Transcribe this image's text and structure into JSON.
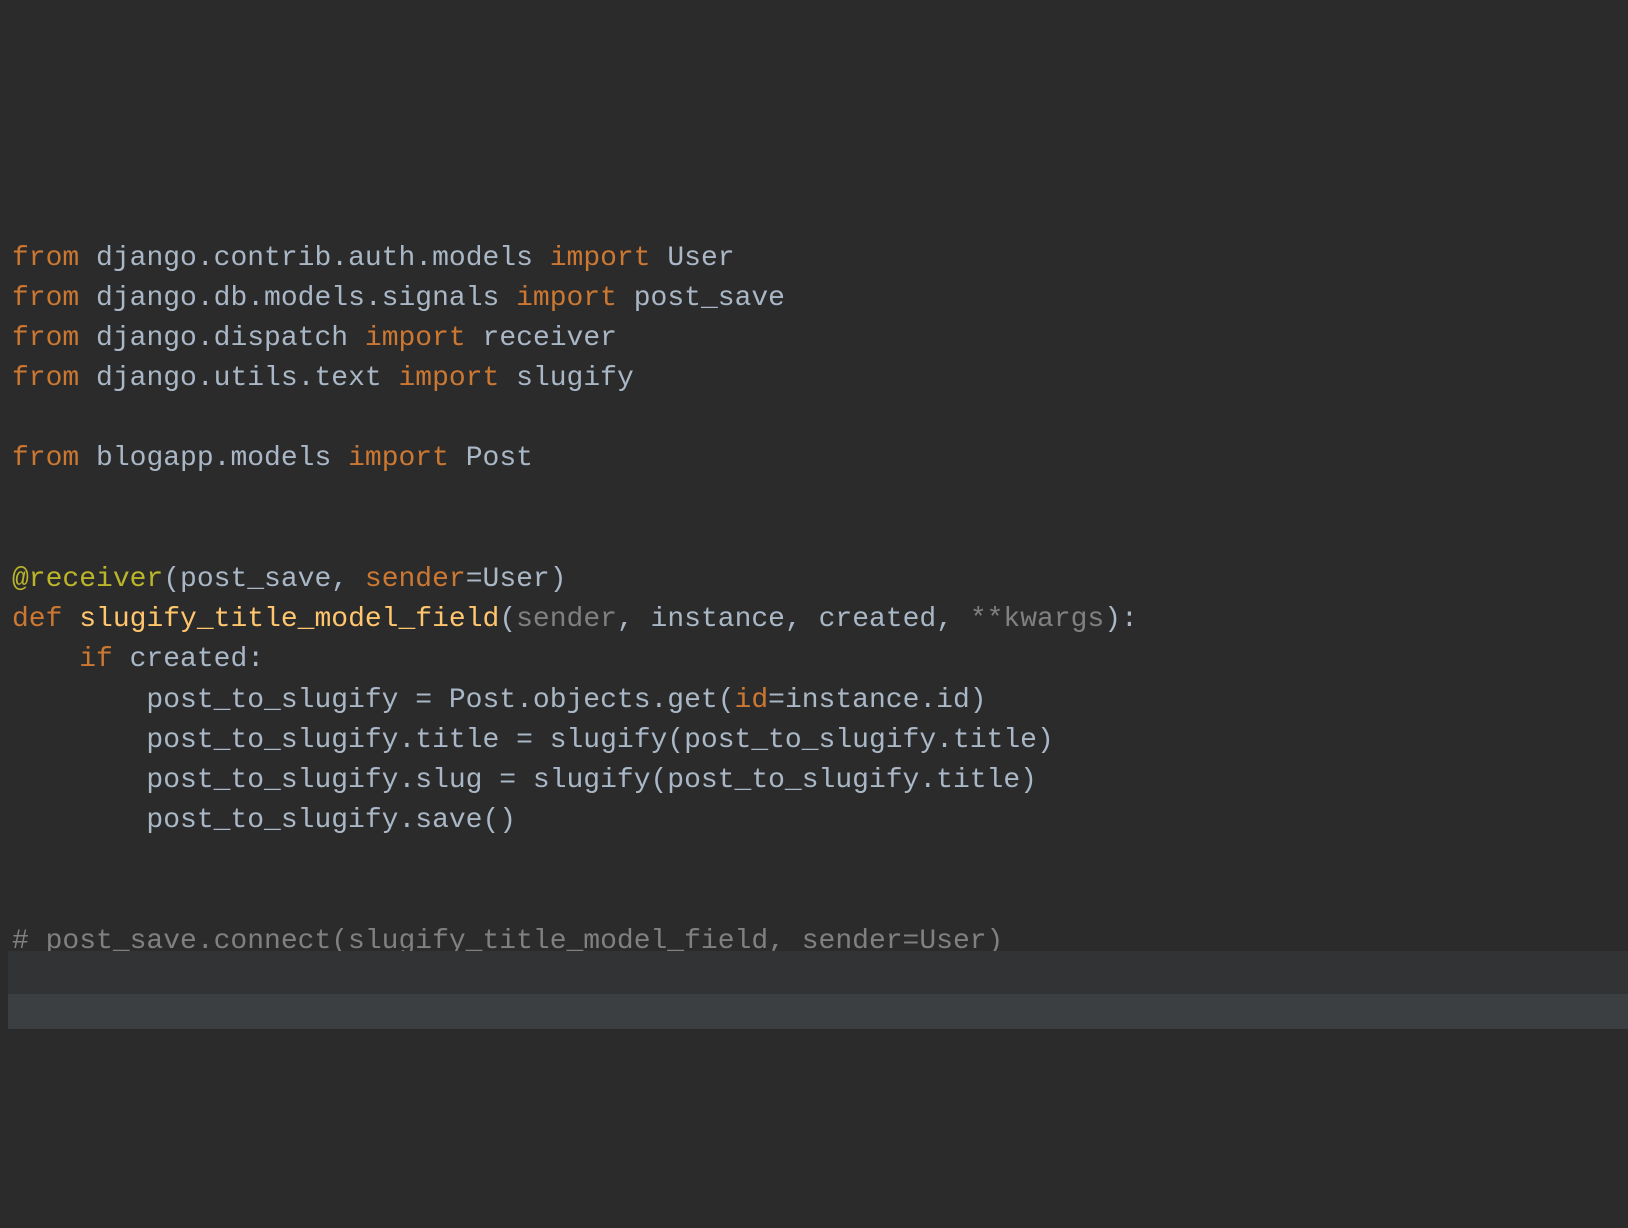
{
  "code": {
    "lines": [
      {
        "type": "import",
        "tokens": [
          {
            "text": "from",
            "class": "kw-from"
          },
          {
            "text": " ",
            "class": ""
          },
          {
            "text": "django.contrib.auth.models",
            "class": "identifier"
          },
          {
            "text": " ",
            "class": ""
          },
          {
            "text": "import",
            "class": "kw-import"
          },
          {
            "text": " ",
            "class": ""
          },
          {
            "text": "User",
            "class": "identifier"
          }
        ]
      },
      {
        "type": "import",
        "tokens": [
          {
            "text": "from",
            "class": "kw-from"
          },
          {
            "text": " ",
            "class": ""
          },
          {
            "text": "django.db.models.signals",
            "class": "identifier"
          },
          {
            "text": " ",
            "class": ""
          },
          {
            "text": "import",
            "class": "kw-import"
          },
          {
            "text": " ",
            "class": ""
          },
          {
            "text": "post_save",
            "class": "identifier"
          }
        ]
      },
      {
        "type": "import",
        "tokens": [
          {
            "text": "from",
            "class": "kw-from"
          },
          {
            "text": " ",
            "class": ""
          },
          {
            "text": "django.dispatch",
            "class": "identifier"
          },
          {
            "text": " ",
            "class": ""
          },
          {
            "text": "import",
            "class": "kw-import"
          },
          {
            "text": " ",
            "class": ""
          },
          {
            "text": "receiver",
            "class": "identifier"
          }
        ]
      },
      {
        "type": "import",
        "tokens": [
          {
            "text": "from",
            "class": "kw-from"
          },
          {
            "text": " ",
            "class": ""
          },
          {
            "text": "django.utils.text",
            "class": "identifier"
          },
          {
            "text": " ",
            "class": ""
          },
          {
            "text": "import",
            "class": "kw-import"
          },
          {
            "text": " ",
            "class": ""
          },
          {
            "text": "slugify",
            "class": "identifier"
          }
        ]
      },
      {
        "type": "blank",
        "tokens": []
      },
      {
        "type": "import",
        "tokens": [
          {
            "text": "from",
            "class": "kw-from"
          },
          {
            "text": " ",
            "class": ""
          },
          {
            "text": "blogapp.models",
            "class": "identifier"
          },
          {
            "text": " ",
            "class": ""
          },
          {
            "text": "import",
            "class": "kw-import"
          },
          {
            "text": " ",
            "class": ""
          },
          {
            "text": "Post",
            "class": "identifier"
          }
        ]
      },
      {
        "type": "blank",
        "tokens": []
      },
      {
        "type": "blank",
        "tokens": []
      },
      {
        "type": "decorator",
        "tokens": [
          {
            "text": "@receiver",
            "class": "decorator"
          },
          {
            "text": "(",
            "class": "paren"
          },
          {
            "text": "post_save",
            "class": "identifier"
          },
          {
            "text": ", ",
            "class": "paren"
          },
          {
            "text": "sender",
            "class": "named-arg"
          },
          {
            "text": "=User)",
            "class": "paren"
          }
        ]
      },
      {
        "type": "funcdef",
        "tokens": [
          {
            "text": "def",
            "class": "kw-def"
          },
          {
            "text": " ",
            "class": ""
          },
          {
            "text": "slugify_title_model_field",
            "class": "func-name"
          },
          {
            "text": "(",
            "class": "paren"
          },
          {
            "text": "sender",
            "class": "param-special"
          },
          {
            "text": ", instance, created, ",
            "class": "param"
          },
          {
            "text": "**kwargs",
            "class": "param-special"
          },
          {
            "text": "):",
            "class": "paren"
          }
        ]
      },
      {
        "type": "if",
        "tokens": [
          {
            "text": "    ",
            "class": ""
          },
          {
            "text": "if",
            "class": "kw-if"
          },
          {
            "text": " created:",
            "class": "identifier"
          }
        ]
      },
      {
        "type": "stmt",
        "tokens": [
          {
            "text": "        post_to_slugify = Post.objects.get(",
            "class": "identifier"
          },
          {
            "text": "id",
            "class": "named-arg"
          },
          {
            "text": "=instance.id)",
            "class": "identifier"
          }
        ]
      },
      {
        "type": "stmt",
        "tokens": [
          {
            "text": "        post_to_slugify.title = slugify(post_to_slugify.title)",
            "class": "identifier"
          }
        ]
      },
      {
        "type": "stmt",
        "tokens": [
          {
            "text": "        post_to_slugify.slug = slugify(post_to_slugify.title)",
            "class": "identifier"
          }
        ]
      },
      {
        "type": "stmt",
        "tokens": [
          {
            "text": "        post_to_slugify.save()",
            "class": "identifier"
          }
        ]
      },
      {
        "type": "blank",
        "tokens": []
      },
      {
        "type": "blank",
        "tokens": []
      },
      {
        "type": "comment",
        "tokens": [
          {
            "text": "# post_save.connect(slugify_title_model_field, sender=User)",
            "class": "comment"
          }
        ]
      }
    ]
  }
}
